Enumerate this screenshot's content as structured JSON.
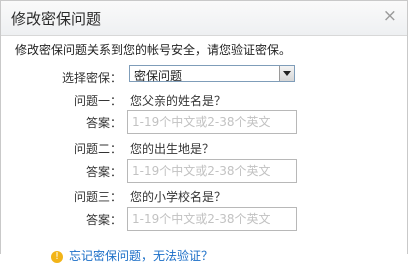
{
  "dialog": {
    "title": "修改密保问题",
    "close_glyph": "×",
    "intro": "修改密保问题关系到您的帐号安全，请您验证密保。"
  },
  "form": {
    "select_label": "选择密保：",
    "select_value": "密保问题",
    "questions": [
      {
        "label": "问题一：",
        "text": "您父亲的姓名是？",
        "answer_label": "答案：",
        "placeholder": "1-19个中文或2-38个英文"
      },
      {
        "label": "问题二：",
        "text": "您的出生地是？",
        "answer_label": "答案：",
        "placeholder": "1-19个中文或2-38个英文"
      },
      {
        "label": "问题三：",
        "text": "您的小学校名是？",
        "answer_label": "答案：",
        "placeholder": "1-19个中文或2-38个英文"
      }
    ]
  },
  "footer": {
    "text": "忘记密保问题，无法验证？"
  }
}
